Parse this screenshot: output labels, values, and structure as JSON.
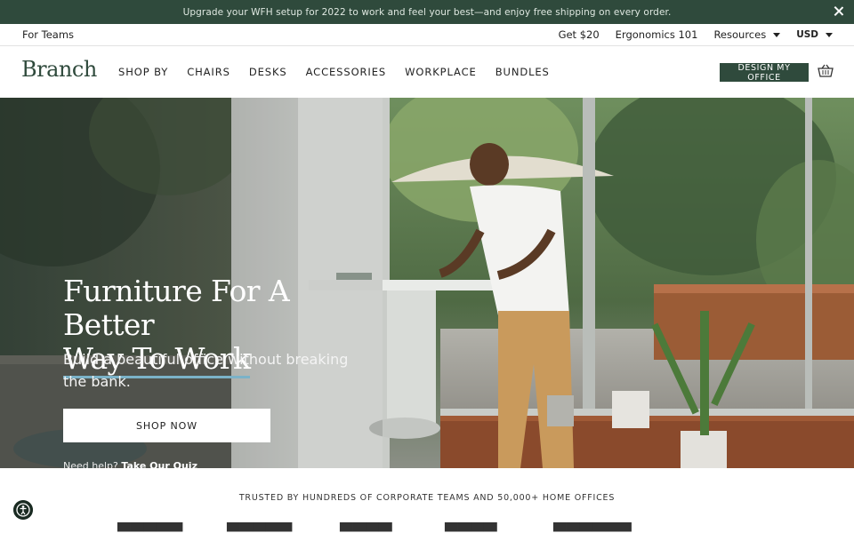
{
  "announcement": {
    "text": "Upgrade your WFH setup for 2022 to work and feel your best—and enjoy free shipping on every order."
  },
  "utility": {
    "for_teams": "For Teams",
    "get20": "Get $20",
    "ergonomics": "Ergonomics 101",
    "resources": "Resources",
    "currency": "USD"
  },
  "nav": {
    "logo": "Branch",
    "links": [
      "SHOP BY",
      "CHAIRS",
      "DESKS",
      "ACCESSORIES",
      "WORKPLACE",
      "BUNDLES"
    ],
    "design_button": "DESIGN MY OFFICE"
  },
  "hero": {
    "title_line1": "Furniture For A Better",
    "title_line2": "Way To Work",
    "subtitle": "Build a beautiful office without breaking the bank.",
    "cta": "SHOP NOW",
    "help_prefix": "Need help?",
    "help_link": "Take Our Quiz"
  },
  "trusted": {
    "text": "TRUSTED BY HUNDREDS OF CORPORATE TEAMS AND 50,000+ HOME OFFICES"
  },
  "colors": {
    "brand": "#2f4a3c",
    "accent": "#7bb2c8"
  }
}
